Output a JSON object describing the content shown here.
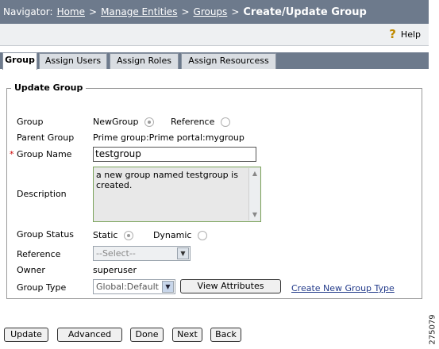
{
  "navigator": {
    "label": "Navigator:",
    "crumbs": [
      "Home",
      "Manage Entities",
      "Groups"
    ],
    "separator": ">",
    "current": "Create/Update Group"
  },
  "help": {
    "label": "Help",
    "icon": "question-mark-icon"
  },
  "tabs": [
    {
      "label": "Group",
      "active": true
    },
    {
      "label": "Assign Users",
      "active": false
    },
    {
      "label": "Assign Roles",
      "active": false
    },
    {
      "label": "Assign Resourcess",
      "active": false
    }
  ],
  "form": {
    "legend": "Update Group",
    "group": {
      "label": "Group",
      "options": [
        {
          "label": "NewGroup",
          "selected": true
        },
        {
          "label": "Reference",
          "selected": false
        }
      ]
    },
    "parent_group": {
      "label": "Parent Group",
      "value": "Prime group:Prime portal:mygroup"
    },
    "group_name": {
      "label": "Group Name",
      "required_marker": "*",
      "value": "testgroup"
    },
    "description": {
      "label": "Description",
      "value": "a new group named testgroup is created."
    },
    "group_status": {
      "label": "Group Status",
      "options": [
        {
          "label": "Static",
          "selected": true
        },
        {
          "label": "Dynamic",
          "selected": false
        }
      ]
    },
    "reference": {
      "label": "Reference",
      "value": "--Select--"
    },
    "owner": {
      "label": "Owner",
      "value": "superuser"
    },
    "group_type": {
      "label": "Group Type",
      "value": "Global:Default",
      "view_button": "View Attributes",
      "create_link": "Create New Group Type"
    }
  },
  "actions": [
    "Update",
    "Advanced",
    "Done",
    "Next",
    "Back"
  ],
  "figure_number": "275079",
  "colors": {
    "header_bg": "#6d7a8c",
    "tab_strip": "#6d7a8c",
    "link": "#223a8a",
    "required": "#cc0000",
    "textarea_border": "#7aa35a"
  }
}
